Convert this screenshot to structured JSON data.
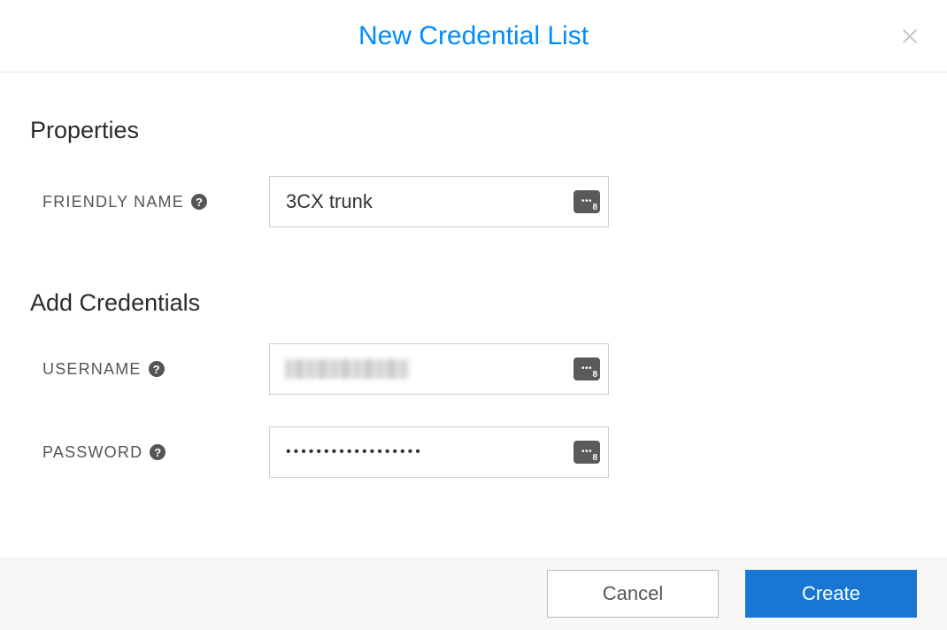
{
  "modal": {
    "title": "New Credential List"
  },
  "sections": {
    "properties_title": "Properties",
    "add_credentials_title": "Add Credentials"
  },
  "fields": {
    "friendly_name": {
      "label": "FRIENDLY NAME",
      "value": "3CX trunk"
    },
    "username": {
      "label": "USERNAME",
      "value": ""
    },
    "password": {
      "label": "PASSWORD",
      "value": "••••••••••••••••••"
    }
  },
  "footer": {
    "cancel_label": "Cancel",
    "create_label": "Create"
  }
}
